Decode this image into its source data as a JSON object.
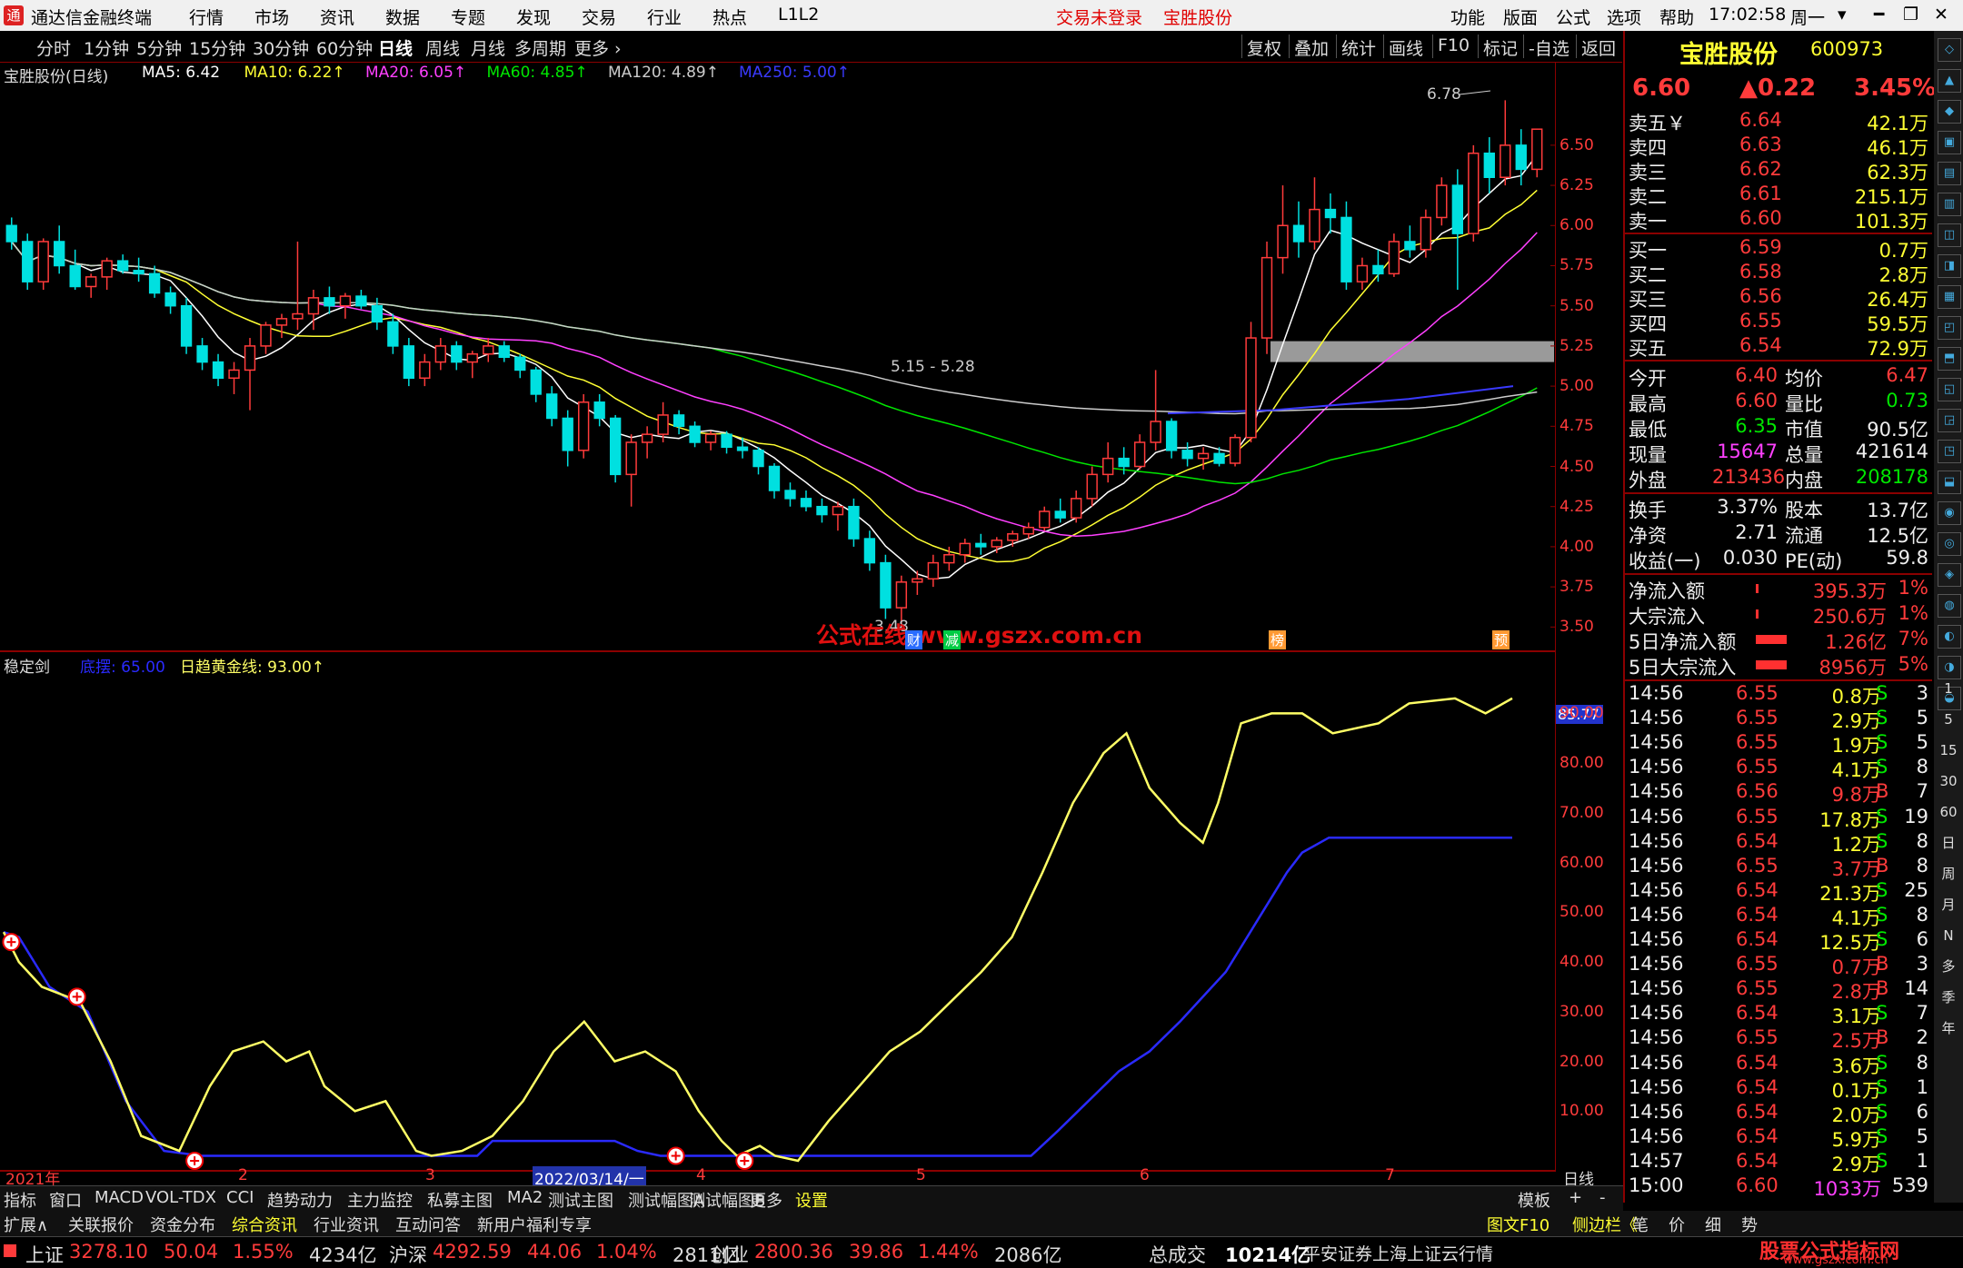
{
  "titlebar": {
    "app_name": "通达信金融终端",
    "menus": [
      "行情",
      "市场",
      "资讯",
      "数据",
      "专题",
      "发现",
      "交易",
      "行业",
      "热点",
      "L1L2"
    ],
    "trade_status": "交易未登录",
    "stock_name": "宝胜股份",
    "right_menus": [
      "功能",
      "版面",
      "公式",
      "选项",
      "帮助"
    ],
    "time": "17:02:58",
    "weekday": "周一",
    "colors": {
      "bar_bg": "#f0f0f0",
      "trade_text": "#e00000"
    }
  },
  "periodbar": {
    "periods": [
      "分时",
      "1分钟",
      "5分钟",
      "15分钟",
      "30分钟",
      "60分钟",
      "日线",
      "周线",
      "月线",
      "多周期",
      "更多"
    ],
    "active": "日线",
    "tools": [
      "复权",
      "叠加",
      "统计",
      "画线",
      "F10",
      "标记",
      "-自选",
      "返回"
    ]
  },
  "kchart": {
    "header": {
      "stock": "宝胜股份(日线)",
      "ma": [
        {
          "label": "MA5: 6.42",
          "color": "#ffffff"
        },
        {
          "label": "MA10: 6.22↑",
          "color": "#ffff33"
        },
        {
          "label": "MA20: 6.05↑",
          "color": "#ff40ff"
        },
        {
          "label": "MA60: 4.85↑",
          "color": "#00e600"
        },
        {
          "label": "MA120: 4.89↑",
          "color": "#cccccc"
        },
        {
          "label": "MA250: 5.00↑",
          "color": "#3a3aff"
        }
      ]
    },
    "high_mark": "6.78",
    "low_mark": "3.48",
    "zone_label": "5.15 - 5.28",
    "watermark": "公式在线 www.gszx.com.cn",
    "tags": [
      "财",
      "减",
      "榜",
      "预"
    ],
    "y_labels": [
      "6.50",
      "6.25",
      "6.00",
      "5.75",
      "5.50",
      "5.25",
      "5.00",
      "4.75",
      "4.50",
      "4.25",
      "4.00",
      "3.75",
      "3.50"
    ],
    "y_range": [
      3.4,
      6.85
    ]
  },
  "indicator": {
    "name": "稳定剑",
    "series": [
      {
        "label": "底摆: 65.00",
        "color": "#2a2aff"
      },
      {
        "label": "日趋黄金线: 93.00↑",
        "color": "#ffff66"
      }
    ],
    "current_value": "85.77",
    "y_labels": [
      "90.00",
      "80.00",
      "70.00",
      "60.00",
      "50.00",
      "40.00",
      "30.00",
      "20.00",
      "10.00"
    ],
    "y_range": [
      0,
      95
    ]
  },
  "xaxis": {
    "labels": [
      "2021年",
      "2",
      "3",
      "2022/03/14/一",
      "4",
      "5",
      "6",
      "7"
    ],
    "period": "日线"
  },
  "quote": {
    "name": "宝胜股份",
    "code": "600973",
    "price": "6.60",
    "change": "▲0.22",
    "pct": "3.45%",
    "asks": [
      {
        "label": "卖五￥",
        "price": "6.64",
        "vol": "42.1万"
      },
      {
        "label": "卖四",
        "price": "6.63",
        "vol": "46.1万"
      },
      {
        "label": "卖三",
        "price": "6.62",
        "vol": "62.3万"
      },
      {
        "label": "卖二",
        "price": "6.61",
        "vol": "215.1万"
      },
      {
        "label": "卖一",
        "price": "6.60",
        "vol": "101.3万"
      }
    ],
    "bids": [
      {
        "label": "买一",
        "price": "6.59",
        "vol": "0.7万"
      },
      {
        "label": "买二",
        "price": "6.58",
        "vol": "2.8万"
      },
      {
        "label": "买三",
        "price": "6.56",
        "vol": "26.4万"
      },
      {
        "label": "买四",
        "price": "6.55",
        "vol": "59.5万"
      },
      {
        "label": "买五",
        "price": "6.54",
        "vol": "72.9万"
      }
    ],
    "stats": [
      {
        "l1": "今开",
        "v1": "6.40",
        "c1": "red",
        "l2": "均价",
        "v2": "6.47",
        "c2": "red"
      },
      {
        "l1": "最高",
        "v1": "6.60",
        "c1": "red",
        "l2": "量比",
        "v2": "0.73",
        "c2": "green"
      },
      {
        "l1": "最低",
        "v1": "6.35",
        "c1": "green",
        "l2": "市值",
        "v2": "90.5亿",
        "c2": "white"
      },
      {
        "l1": "现量",
        "v1": "15647",
        "c1": "magenta",
        "l2": "总量",
        "v2": "421614",
        "c2": "white"
      },
      {
        "l1": "外盘",
        "v1": "213436",
        "c1": "red",
        "l2": "内盘",
        "v2": "208178",
        "c2": "green"
      }
    ],
    "fin": [
      {
        "l1": "换手",
        "v1": "3.37%",
        "l2": "股本",
        "v2": "13.7亿"
      },
      {
        "l1": "净资",
        "v1": "2.71",
        "l2": "流通",
        "v2": "12.5亿"
      },
      {
        "l1": "收益(一)",
        "v1": "0.030",
        "l2": "PE(动)",
        "v2": "59.8"
      }
    ],
    "flows": [
      {
        "label": "净流入额",
        "value": "395.3万",
        "pct": "1%"
      },
      {
        "label": "大宗流入",
        "value": "250.6万",
        "pct": "1%"
      },
      {
        "label": "5日净流入额",
        "value": "1.26亿",
        "pct": "7%"
      },
      {
        "label": "5日大宗流入",
        "value": "8956万",
        "pct": "5%"
      }
    ],
    "ticks": [
      {
        "t": "14:56",
        "p": "6.55",
        "v": "0.8万",
        "d": "S",
        "n": "3"
      },
      {
        "t": "14:56",
        "p": "6.55",
        "v": "2.9万",
        "d": "S",
        "n": "5"
      },
      {
        "t": "14:56",
        "p": "6.55",
        "v": "1.9万",
        "d": "S",
        "n": "5"
      },
      {
        "t": "14:56",
        "p": "6.55",
        "v": "4.1万",
        "d": "S",
        "n": "8"
      },
      {
        "t": "14:56",
        "p": "6.56",
        "v": "9.8万",
        "d": "B",
        "n": "7"
      },
      {
        "t": "14:56",
        "p": "6.55",
        "v": "17.8万",
        "d": "S",
        "n": "19"
      },
      {
        "t": "14:56",
        "p": "6.54",
        "v": "1.2万",
        "d": "S",
        "n": "8"
      },
      {
        "t": "14:56",
        "p": "6.55",
        "v": "3.7万",
        "d": "B",
        "n": "8"
      },
      {
        "t": "14:56",
        "p": "6.54",
        "v": "21.3万",
        "d": "S",
        "n": "25"
      },
      {
        "t": "14:56",
        "p": "6.54",
        "v": "4.1万",
        "d": "S",
        "n": "8"
      },
      {
        "t": "14:56",
        "p": "6.54",
        "v": "12.5万",
        "d": "S",
        "n": "6"
      },
      {
        "t": "14:56",
        "p": "6.55",
        "v": "0.7万",
        "d": "B",
        "n": "3"
      },
      {
        "t": "14:56",
        "p": "6.55",
        "v": "2.8万",
        "d": "B",
        "n": "14"
      },
      {
        "t": "14:56",
        "p": "6.54",
        "v": "3.1万",
        "d": "S",
        "n": "7"
      },
      {
        "t": "14:56",
        "p": "6.55",
        "v": "2.5万",
        "d": "B",
        "n": "2"
      },
      {
        "t": "14:56",
        "p": "6.54",
        "v": "3.6万",
        "d": "S",
        "n": "8"
      },
      {
        "t": "14:56",
        "p": "6.54",
        "v": "0.1万",
        "d": "S",
        "n": "1"
      },
      {
        "t": "14:56",
        "p": "6.54",
        "v": "2.0万",
        "d": "S",
        "n": "6"
      },
      {
        "t": "14:56",
        "p": "6.54",
        "v": "5.9万",
        "d": "S",
        "n": "5"
      },
      {
        "t": "14:57",
        "p": "6.54",
        "v": "2.9万",
        "d": "S",
        "n": "1"
      },
      {
        "t": "15:00",
        "p": "6.60",
        "v": "1033万",
        "d": "",
        "n": "539"
      }
    ]
  },
  "rtoolbar": {
    "periods": [
      "1",
      "5",
      "15",
      "30",
      "60",
      "日",
      "周",
      "月",
      "N",
      "多",
      "季",
      "年"
    ]
  },
  "tabbar1": {
    "tabs": [
      "指标",
      "窗口",
      "MACD",
      "VOL-TDX",
      "CCI",
      "趋势动力",
      "主力监控",
      "私募主图",
      "MA2",
      "测试主图",
      "测试幅图A",
      "测试幅图B",
      "更多",
      "设置"
    ],
    "right": [
      "模板",
      "+",
      "-"
    ]
  },
  "tabbar2": {
    "tabs": [
      "扩展∧",
      "关联报价",
      "资金分布",
      "综合资讯",
      "行业资讯",
      "互动问答",
      "新用户福利专享"
    ],
    "right": [
      "图文F10",
      "侧边栏《",
      "笔",
      "价",
      "细",
      "势"
    ]
  },
  "statusbar": {
    "indices": [
      {
        "name": "上证",
        "value": "3278.10",
        "chg": "50.04",
        "pct": "1.55%",
        "amt": "4234亿"
      },
      {
        "name": "沪深",
        "value": "4292.59",
        "chg": "44.06",
        "pct": "1.04%",
        "amt": "2811亿"
      },
      {
        "name": "创业",
        "value": "2800.36",
        "chg": "39.86",
        "pct": "1.44%",
        "amt": "2086亿"
      }
    ],
    "total_label": "总成交",
    "total_value": "10214亿",
    "broker": "平安证券上海上证云行情",
    "site_logo": "股票公式指标网",
    "site_url": "www.gszx.com.cn"
  },
  "chart_data": {
    "type": "candlestick",
    "y_range": [
      3.4,
      6.85
    ],
    "candles": [
      [
        6.0,
        6.05,
        5.85,
        5.9
      ],
      [
        5.9,
        5.95,
        5.6,
        5.65
      ],
      [
        5.65,
        5.92,
        5.6,
        5.9
      ],
      [
        5.9,
        6.0,
        5.7,
        5.75
      ],
      [
        5.75,
        5.85,
        5.6,
        5.62
      ],
      [
        5.62,
        5.7,
        5.55,
        5.68
      ],
      [
        5.68,
        5.8,
        5.6,
        5.78
      ],
      [
        5.78,
        5.82,
        5.7,
        5.72
      ],
      [
        5.72,
        5.8,
        5.65,
        5.7
      ],
      [
        5.7,
        5.75,
        5.55,
        5.58
      ],
      [
        5.58,
        5.62,
        5.45,
        5.5
      ],
      [
        5.5,
        5.55,
        5.2,
        5.25
      ],
      [
        5.25,
        5.3,
        5.1,
        5.15
      ],
      [
        5.15,
        5.2,
        5.0,
        5.05
      ],
      [
        5.05,
        5.15,
        4.95,
        5.1
      ],
      [
        5.1,
        5.3,
        4.85,
        5.25
      ],
      [
        5.25,
        5.4,
        5.2,
        5.38
      ],
      [
        5.38,
        5.45,
        5.3,
        5.42
      ],
      [
        5.42,
        5.9,
        5.35,
        5.45
      ],
      [
        5.45,
        5.6,
        5.35,
        5.55
      ],
      [
        5.55,
        5.62,
        5.45,
        5.5
      ],
      [
        5.5,
        5.58,
        5.42,
        5.56
      ],
      [
        5.56,
        5.6,
        5.48,
        5.5
      ],
      [
        5.5,
        5.55,
        5.35,
        5.4
      ],
      [
        5.4,
        5.45,
        5.2,
        5.25
      ],
      [
        5.25,
        5.3,
        5.0,
        5.05
      ],
      [
        5.05,
        5.2,
        5.0,
        5.15
      ],
      [
        5.15,
        5.3,
        5.1,
        5.25
      ],
      [
        5.25,
        5.28,
        5.1,
        5.15
      ],
      [
        5.15,
        5.22,
        5.05,
        5.2
      ],
      [
        5.2,
        5.3,
        5.15,
        5.25
      ],
      [
        5.25,
        5.28,
        5.15,
        5.18
      ],
      [
        5.18,
        5.2,
        5.05,
        5.1
      ],
      [
        5.1,
        5.12,
        4.9,
        4.95
      ],
      [
        4.95,
        5.0,
        4.75,
        4.8
      ],
      [
        4.8,
        4.85,
        4.5,
        4.6
      ],
      [
        4.6,
        4.95,
        4.55,
        4.9
      ],
      [
        4.9,
        4.95,
        4.75,
        4.8
      ],
      [
        4.8,
        4.82,
        4.4,
        4.45
      ],
      [
        4.45,
        4.7,
        4.25,
        4.65
      ],
      [
        4.65,
        4.75,
        4.55,
        4.7
      ],
      [
        4.7,
        4.9,
        4.65,
        4.82
      ],
      [
        4.82,
        4.85,
        4.7,
        4.75
      ],
      [
        4.75,
        4.78,
        4.62,
        4.65
      ],
      [
        4.65,
        4.72,
        4.6,
        4.7
      ],
      [
        4.7,
        4.72,
        4.58,
        4.62
      ],
      [
        4.62,
        4.68,
        4.55,
        4.6
      ],
      [
        4.6,
        4.62,
        4.45,
        4.5
      ],
      [
        4.5,
        4.52,
        4.3,
        4.35
      ],
      [
        4.35,
        4.4,
        4.25,
        4.3
      ],
      [
        4.3,
        4.35,
        4.22,
        4.25
      ],
      [
        4.25,
        4.3,
        4.15,
        4.2
      ],
      [
        4.2,
        4.28,
        4.1,
        4.25
      ],
      [
        4.25,
        4.3,
        4.0,
        4.05
      ],
      [
        4.05,
        4.1,
        3.85,
        3.9
      ],
      [
        3.9,
        3.95,
        3.55,
        3.62
      ],
      [
        3.62,
        3.82,
        3.48,
        3.78
      ],
      [
        3.78,
        3.85,
        3.7,
        3.8
      ],
      [
        3.8,
        3.95,
        3.75,
        3.9
      ],
      [
        3.9,
        4.0,
        3.85,
        3.95
      ],
      [
        3.95,
        4.05,
        3.9,
        4.02
      ],
      [
        4.02,
        4.08,
        3.95,
        4.0
      ],
      [
        4.0,
        4.06,
        3.96,
        4.04
      ],
      [
        4.04,
        4.1,
        4.0,
        4.08
      ],
      [
        4.08,
        4.15,
        4.05,
        4.12
      ],
      [
        4.12,
        4.25,
        4.1,
        4.22
      ],
      [
        4.22,
        4.3,
        4.15,
        4.18
      ],
      [
        4.18,
        4.35,
        4.15,
        4.3
      ],
      [
        4.3,
        4.5,
        4.25,
        4.45
      ],
      [
        4.45,
        4.65,
        4.4,
        4.55
      ],
      [
        4.55,
        4.62,
        4.45,
        4.5
      ],
      [
        4.5,
        4.7,
        4.48,
        4.65
      ],
      [
        4.65,
        5.1,
        4.6,
        4.78
      ],
      [
        4.78,
        4.8,
        4.55,
        4.6
      ],
      [
        4.6,
        4.65,
        4.5,
        4.55
      ],
      [
        4.55,
        4.62,
        4.48,
        4.58
      ],
      [
        4.58,
        4.62,
        4.5,
        4.52
      ],
      [
        4.52,
        4.7,
        4.5,
        4.68
      ],
      [
        4.68,
        5.4,
        4.65,
        5.3
      ],
      [
        5.3,
        5.9,
        5.2,
        5.8
      ],
      [
        5.8,
        6.25,
        5.7,
        6.0
      ],
      [
        6.0,
        6.15,
        5.8,
        5.9
      ],
      [
        5.9,
        6.3,
        5.85,
        6.1
      ],
      [
        6.1,
        6.2,
        5.95,
        6.05
      ],
      [
        6.05,
        6.15,
        5.6,
        5.65
      ],
      [
        5.65,
        5.8,
        5.6,
        5.75
      ],
      [
        5.75,
        5.85,
        5.65,
        5.7
      ],
      [
        5.7,
        5.95,
        5.68,
        5.9
      ],
      [
        5.9,
        6.0,
        5.8,
        5.85
      ],
      [
        5.85,
        6.1,
        5.8,
        6.05
      ],
      [
        6.05,
        6.3,
        6.0,
        6.25
      ],
      [
        6.25,
        6.35,
        5.6,
        5.95
      ],
      [
        5.95,
        6.5,
        5.9,
        6.45
      ],
      [
        6.45,
        6.55,
        6.2,
        6.3
      ],
      [
        6.3,
        6.78,
        6.25,
        6.5
      ],
      [
        6.5,
        6.6,
        6.25,
        6.35
      ],
      [
        6.35,
        6.6,
        6.3,
        6.6
      ]
    ]
  }
}
